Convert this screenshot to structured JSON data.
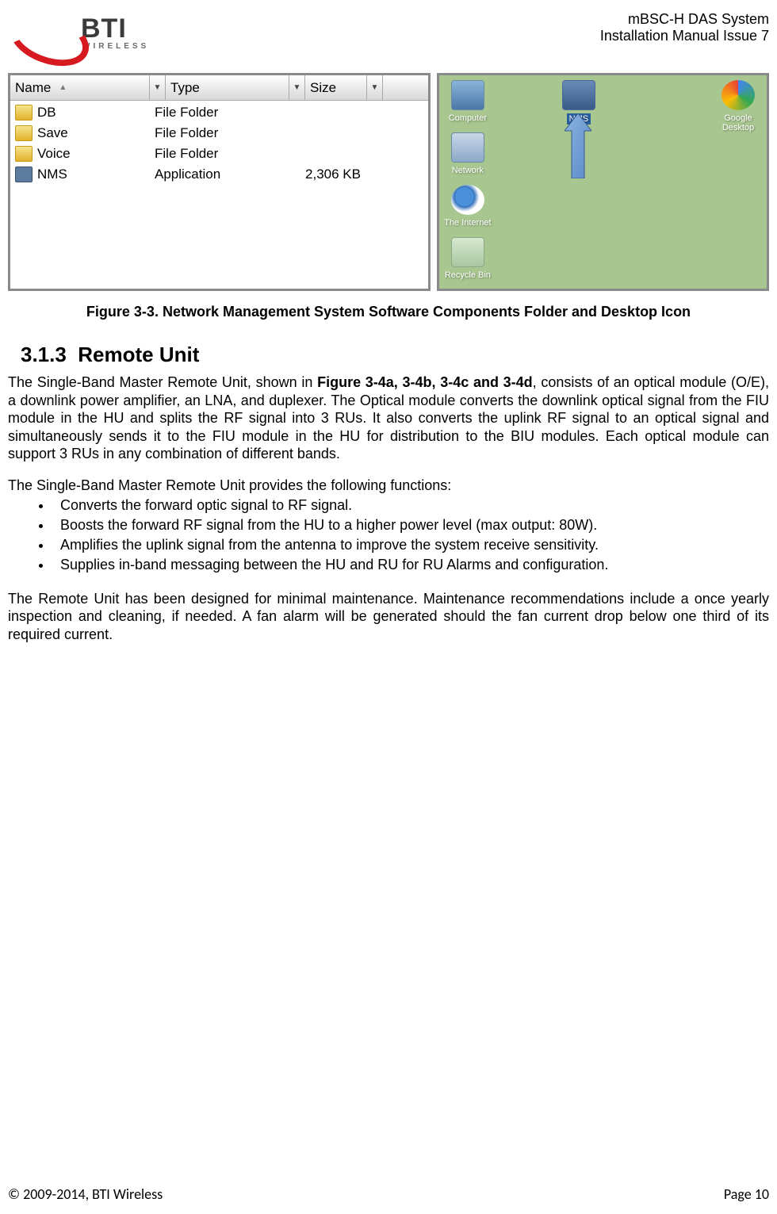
{
  "header": {
    "logo_main": "BTI",
    "logo_sub": "WIRELESS",
    "title_line1": "mBSC-H DAS System",
    "title_line2": "Installation Manual Issue 7"
  },
  "explorer": {
    "columns": {
      "name": "Name",
      "type": "Type",
      "size": "Size"
    },
    "rows": [
      {
        "name": "DB",
        "type": "File Folder",
        "size": "",
        "icon": "folder"
      },
      {
        "name": "Save",
        "type": "File Folder",
        "size": "",
        "icon": "folder"
      },
      {
        "name": "Voice",
        "type": "File Folder",
        "size": "",
        "icon": "folder"
      },
      {
        "name": "NMS",
        "type": "Application",
        "size": "2,306 KB",
        "icon": "app"
      }
    ]
  },
  "desktop": {
    "icons": {
      "computer": "Computer",
      "network": "Network",
      "internet": "The Internet",
      "recycle": "Recycle Bin",
      "nms": "NMS",
      "google": "Google Desktop"
    }
  },
  "figure_caption": "Figure 3-3. Network Management System Software Components Folder and Desktop Icon",
  "section": {
    "number": "3.1.3",
    "title": "Remote Unit"
  },
  "paragraphs": {
    "p1_pre": "The Single-Band Master Remote Unit, shown in ",
    "p1_bold": "Figure 3-4a, 3-4b, 3-4c and 3-4d",
    "p1_post": ", consists of an optical module (O/E), a downlink power amplifier, an LNA, and duplexer. The Optical module converts the downlink optical signal from the FIU module in the HU and splits the RF signal into 3 RUs. It also converts the uplink RF signal to an optical signal and simultaneously sends it to the FIU module in the HU for distribution to the BIU modules. Each optical module can support 3 RUs in any combination of different bands.",
    "p2": "The Single-Band Master Remote Unit provides the following functions:",
    "p3": "The Remote Unit has been designed for minimal maintenance. Maintenance recommendations include a once yearly inspection and cleaning, if needed. A fan alarm will be generated should the fan current drop below one third of its required current."
  },
  "bullets": [
    "Converts the forward optic signal to RF signal.",
    "Boosts the forward RF signal from the HU to a higher power level (max output: 80W).",
    "Amplifies the uplink signal from the antenna to improve the system receive sensitivity.",
    "Supplies in-band messaging between the HU and RU for RU Alarms and configuration."
  ],
  "footer": {
    "copyright": "© 2009-2014, BTI Wireless",
    "page_label": "Page ",
    "page_number": "10"
  }
}
